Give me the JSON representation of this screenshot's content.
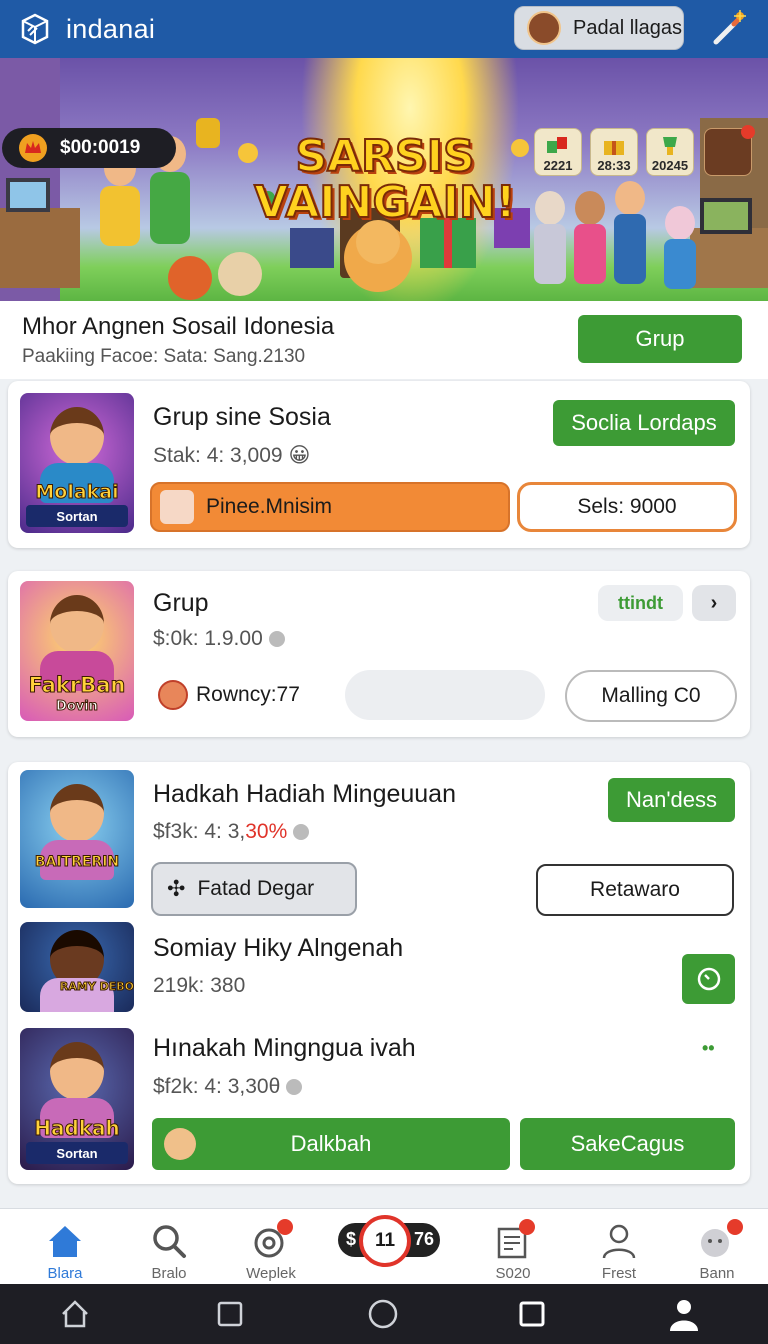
{
  "app": {
    "title": "indanai",
    "user_name": "Padal llagas"
  },
  "hero": {
    "coin_value": "$00:0019",
    "title_line1": "SARSIS",
    "title_line2": "VAINGAIN!",
    "stats": [
      "2221",
      "28:33",
      "20245"
    ]
  },
  "section": {
    "title": "Mhor Angnen Sosail Idonesia",
    "subtitle": "Paakiing Facoe: Sata: Sang.2130",
    "button": "Grup"
  },
  "cards": [
    {
      "thumb_caption": "Molakai",
      "thumb_sub": "Sortan",
      "title": "Grup sine Sosia",
      "sub": "Stak: 4: 3,009",
      "top_button": "Soclia Lordaps",
      "pill_label": "Pinee.Mnisim",
      "outline_button": "Sels: 9000"
    },
    {
      "thumb_caption": "FakrBan",
      "thumb_sub": "Dovin",
      "title": "Grup",
      "sub": "$:0k: 1.9.00",
      "tag": "ttindt",
      "next_label": "›",
      "pill_label": "Rowncy:77",
      "outline_button": "Malling C0"
    },
    {
      "items": [
        {
          "thumb_caption": "BAITRERIN",
          "title": "Hadkah Hadiah Mingeuuan",
          "sub": "$f3k: 4: 3,",
          "sub_highlight": "30%",
          "top_button": "Nan'dess",
          "pill_label": "Fatad Degar",
          "outline_button": "Retawaro"
        },
        {
          "thumb_caption": "RAMY DEBOC",
          "title": "Somiay Hiky Alngenah",
          "sub": "219k: 380"
        },
        {
          "thumb_caption": "Hadkah",
          "thumb_sub": "Sortan",
          "title": "Hınakah Mingngua ivah",
          "sub": "$f2k: 4: 3,30θ",
          "more_label": "••",
          "left_button": "Dalkbah",
          "right_button": "SakeCagus"
        }
      ]
    }
  ],
  "bottom_nav": {
    "items": [
      "Blara",
      "Bralo",
      "Weplek",
      "S020",
      "Frest",
      "Bann"
    ],
    "center_left": "$",
    "center_right": "76",
    "center_value": "11"
  },
  "colors": {
    "primary": "#1f5aa6",
    "green": "#3d9b35",
    "orange": "#f28a36",
    "badge": "#e53b2a"
  }
}
